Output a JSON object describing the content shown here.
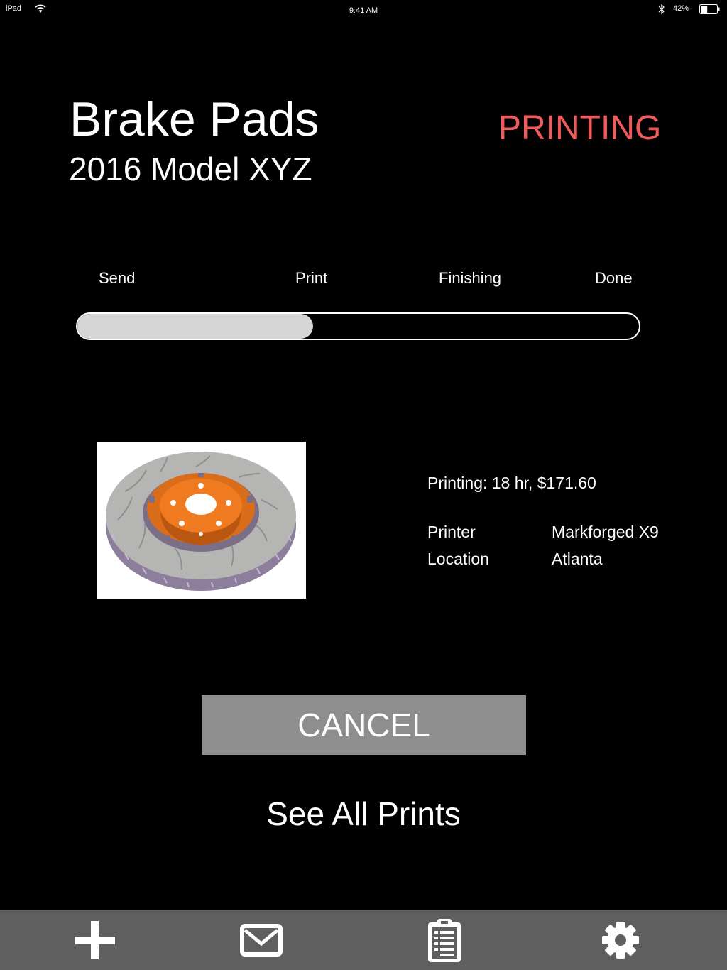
{
  "status_bar": {
    "device": "iPad",
    "time": "9:41 AM",
    "battery_percent": "42%",
    "battery_level": 0.42
  },
  "header": {
    "title": "Brake Pads",
    "subtitle": "2016 Model XYZ",
    "status": "PRINTING",
    "status_color": "#ef5a5a"
  },
  "progress": {
    "steps": [
      "Send",
      "Print",
      "Finishing",
      "Done"
    ],
    "fraction": 0.42
  },
  "details": {
    "summary": "Printing: 18 hr, $171.60",
    "printer_label": "Printer",
    "printer_value": "Markforged X9",
    "location_label": "Location",
    "location_value": "Atlanta"
  },
  "actions": {
    "cancel_label": "CANCEL",
    "see_all_label": "See All Prints"
  },
  "tab_bar": {
    "icons": [
      "add-icon",
      "mail-icon",
      "clipboard-icon",
      "settings-icon"
    ]
  },
  "colors": {
    "background": "#000000",
    "accent": "#ef5a5a",
    "tab_bar": "#5f5f5f",
    "button": "#8e8e8e",
    "progress_fill": "#d6d6d6"
  }
}
